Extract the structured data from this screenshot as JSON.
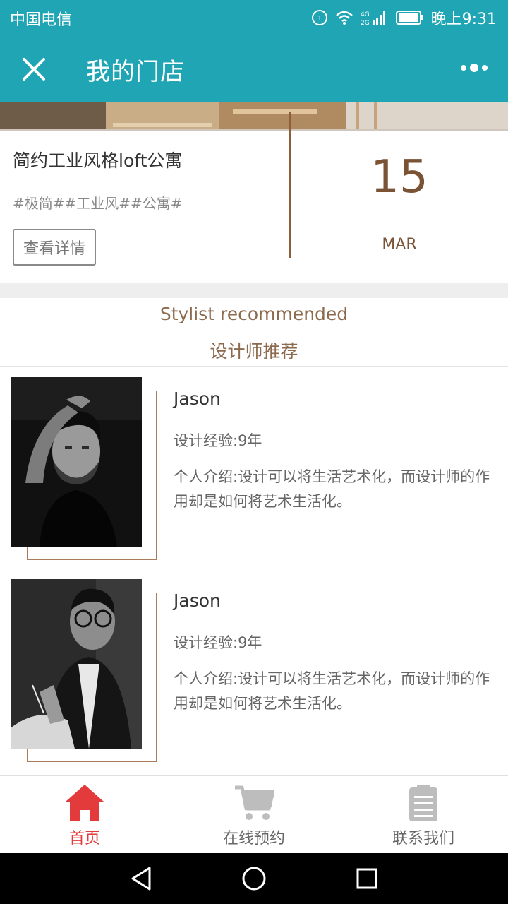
{
  "status_bar": {
    "carrier": "中国电信",
    "network_badge": "4G",
    "signal_text": "4G 2G",
    "time": "晚上9:31",
    "icons": [
      "data-icon",
      "wifi-icon",
      "signal-icon",
      "battery-icon"
    ]
  },
  "header": {
    "title": "我的门店",
    "close_icon": "close-icon",
    "more_icon": "more-icon"
  },
  "store": {
    "title": "简约工业风格loft公寓",
    "tags": "#极简##工业风##公寓#",
    "detail_button": "查看详情",
    "date_day": "15",
    "date_month": "MAR"
  },
  "stylists": {
    "heading_en": "Stylist recommended",
    "heading_zh": "设计师推荐",
    "items": [
      {
        "name": "Jason",
        "experience": "设计经验:9年",
        "intro": "个人介绍:设计可以将生活艺术化，而设计师的作用却是如何将艺术生活化。"
      },
      {
        "name": "Jason",
        "experience": "设计经验:9年",
        "intro": "个人介绍:设计可以将生活艺术化，而设计师的作用却是如何将艺术生活化。"
      }
    ]
  },
  "tabs": [
    {
      "label": "首页",
      "icon": "home-icon",
      "active": true
    },
    {
      "label": "在线预约",
      "icon": "cart-icon",
      "active": false
    },
    {
      "label": "联系我们",
      "icon": "clipboard-icon",
      "active": false
    }
  ],
  "colors": {
    "header_bg": "#20a5b4",
    "accent_brown": "#8b6a4e",
    "active_tab": "#e33b3b"
  }
}
